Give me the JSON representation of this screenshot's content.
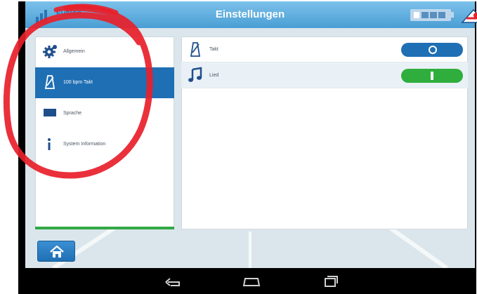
{
  "header": {
    "title": "Einstellungen",
    "logo_text": "Fusion"
  },
  "sidebar": {
    "items": [
      {
        "label": "Allgemein",
        "icon": "gear-icon",
        "active": false
      },
      {
        "label": "100 bpm Takt",
        "icon": "metronome-icon",
        "active": true
      },
      {
        "label": "Sprache",
        "icon": "flag-icon",
        "active": false
      },
      {
        "label": "System Information",
        "icon": "info-icon",
        "active": false
      }
    ]
  },
  "settings": {
    "rows": [
      {
        "label": "Takt",
        "icon": "metronome-icon",
        "toggle": "off"
      },
      {
        "label": "Lied",
        "icon": "music-note-icon",
        "toggle": "on"
      }
    ]
  },
  "colors": {
    "header": "#4a9ed4",
    "active_item": "#1f6fb5",
    "toggle_off": "#1f6fb5",
    "toggle_on": "#2fae3e",
    "accent_bar": "#33a845",
    "annotation": "#e8202a"
  },
  "navbar": {
    "icons": [
      "back-icon",
      "home-nav-icon",
      "recents-icon"
    ]
  }
}
